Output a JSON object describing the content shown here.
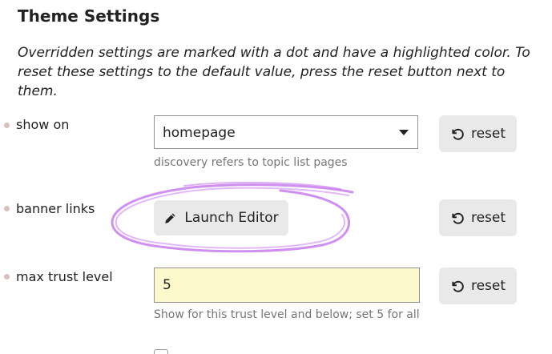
{
  "header": {
    "title": "Theme Settings",
    "intro": "Overridden settings are marked with a dot and have a highlighted color. To reset these settings to the default value, press the reset button next to them."
  },
  "settings": {
    "show_on": {
      "label": "show on",
      "selected": "homepage",
      "help": "discovery refers to topic list pages",
      "reset_label": "reset"
    },
    "banner_links": {
      "label": "banner links",
      "button_label": "Launch Editor",
      "reset_label": "reset"
    },
    "max_trust_level": {
      "label": "max trust level",
      "value": "5",
      "help": "Show for this trust level and below; set 5 for all",
      "reset_label": "reset"
    }
  },
  "colors": {
    "annotation": "#c77dec",
    "input_highlight": "#fef9cc",
    "button_bg": "#e9e9e9",
    "dot": "#d9c0c0"
  },
  "icons": {
    "reset": "undo-icon",
    "editor": "pencil-icon",
    "dropdown": "caret-down-icon"
  }
}
